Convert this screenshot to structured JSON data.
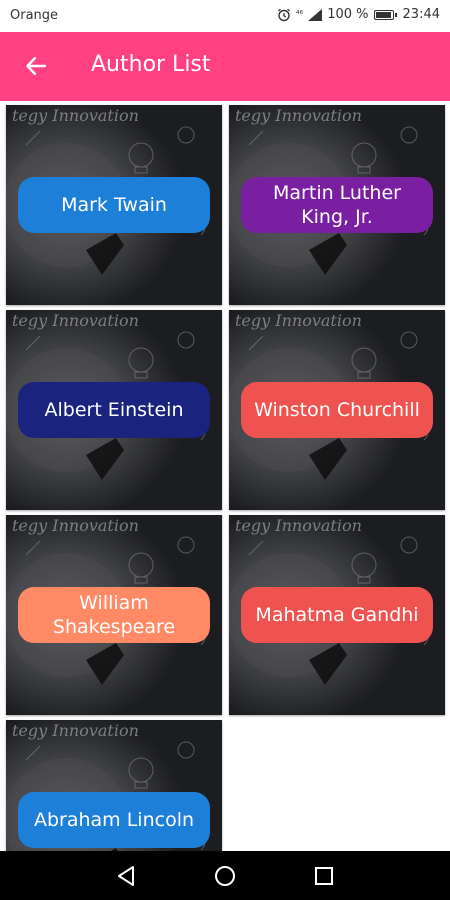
{
  "status_bar": {
    "carrier": "Orange",
    "signal_text": "⁴⁶",
    "battery_percent": "100 %",
    "battery_level": 1.0,
    "time": "23:44"
  },
  "app_bar": {
    "title": "Author List",
    "background_color": "#ff4081"
  },
  "card_background_text": "tegy Innovation",
  "authors": [
    {
      "name": "Mark Twain",
      "color": "#1e7fd8"
    },
    {
      "name": "Martin Luther King, Jr.",
      "color": "#7b1fa2"
    },
    {
      "name": "Albert Einstein",
      "color": "#1a237e"
    },
    {
      "name": "Winston Churchill",
      "color": "#ef5350"
    },
    {
      "name": "William Shakespeare",
      "color": "#ff8a65"
    },
    {
      "name": "Mahatma Gandhi",
      "color": "#ef5350"
    },
    {
      "name": "Abraham Lincoln",
      "color": "#1e7fd8"
    }
  ],
  "icons": {
    "back": "arrow-left-icon",
    "alarm": "alarm-clock-icon",
    "battery": "battery-icon",
    "nav_back": "triangle-back-icon",
    "nav_home": "circle-home-icon",
    "nav_recents": "square-recents-icon"
  }
}
